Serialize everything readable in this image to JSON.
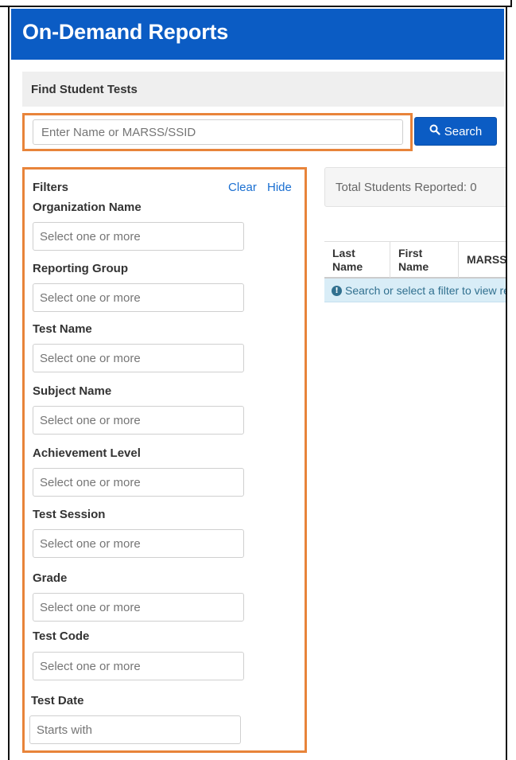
{
  "header": {
    "title": "On-Demand Reports"
  },
  "find_panel": {
    "label": "Find Student Tests"
  },
  "search": {
    "placeholder": "Enter Name or MARSS/SSID",
    "button_label": "Search",
    "button_icon": "search-icon"
  },
  "filters": {
    "title": "Filters",
    "clear_label": "Clear",
    "hide_label": "Hide",
    "items": [
      {
        "label": "Organization Name",
        "placeholder": "Select one or more"
      },
      {
        "label": "Reporting Group",
        "placeholder": "Select one or more"
      },
      {
        "label": "Test Name",
        "placeholder": "Select one or more"
      },
      {
        "label": "Subject Name",
        "placeholder": "Select one or more"
      },
      {
        "label": "Achievement Level",
        "placeholder": "Select one or more"
      },
      {
        "label": "Test Session",
        "placeholder": "Select one or more"
      },
      {
        "label": "Grade",
        "placeholder": "Select one or more"
      },
      {
        "label": "Test Code",
        "placeholder": "Select one or more"
      },
      {
        "label": "Test Date",
        "placeholder": "Starts with"
      }
    ]
  },
  "results": {
    "total_text": "Total Students Reported: 0",
    "columns": [
      {
        "line1": "Last",
        "line2": "Name"
      },
      {
        "line1": "First",
        "line2": "Name"
      },
      {
        "line1": "MARSS",
        "line2": ""
      }
    ],
    "info_message": "Search or select a filter to view results",
    "info_icon": "info-circle-icon"
  },
  "colors": {
    "brand_blue": "#0b5cc4",
    "highlight_orange": "#e8843a",
    "info_bg": "#d9edf7",
    "link_blue": "#1a6fd1"
  }
}
